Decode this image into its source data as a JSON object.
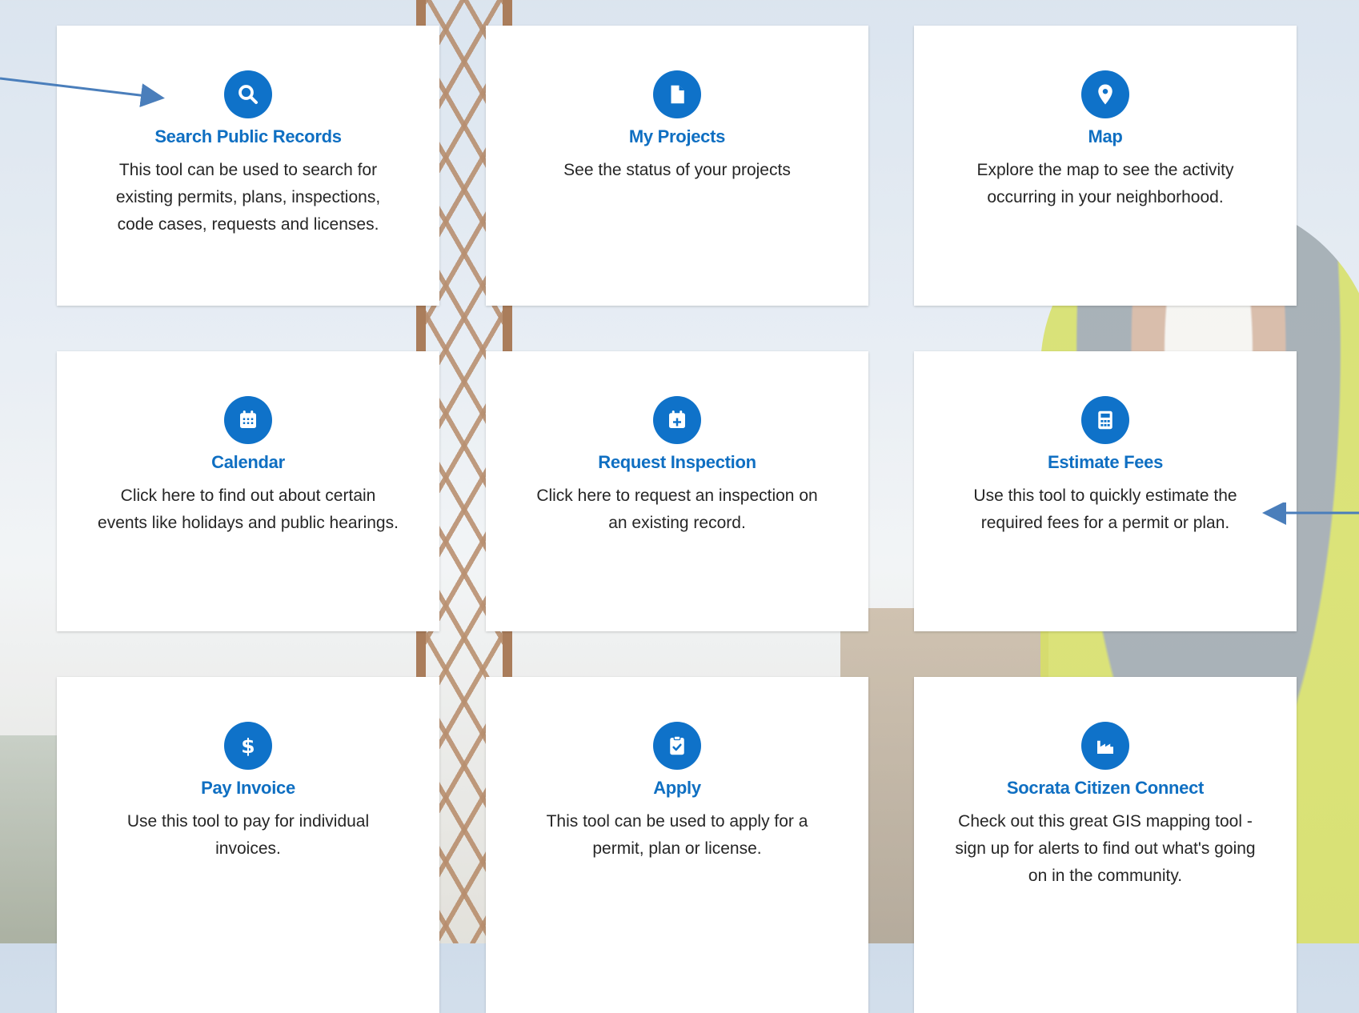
{
  "colors": {
    "accent": "#0f72c9",
    "title": "#0f6fc2",
    "text": "#262626",
    "arrow": "#4a7ebb"
  },
  "cards": [
    {
      "title": "Search Public Records",
      "desc": "This tool can be used to search for existing permits, plans, inspections, code cases, requests and licenses.",
      "icon": "search-icon"
    },
    {
      "title": "My Projects",
      "desc": "See the status of your projects",
      "icon": "document-icon"
    },
    {
      "title": "Map",
      "desc": "Explore the map to see the activity occurring in your neighborhood.",
      "icon": "map-pin-icon"
    },
    {
      "title": "Calendar",
      "desc": "Click here to find out about certain events like holidays and public hearings.",
      "icon": "calendar-icon"
    },
    {
      "title": "Request Inspection",
      "desc": "Click here to request an inspection on an existing record.",
      "icon": "calendar-plus-icon"
    },
    {
      "title": "Estimate Fees",
      "desc": "Use this tool to quickly estimate the required fees for a permit or plan.",
      "icon": "calculator-icon"
    },
    {
      "title": "Pay Invoice",
      "desc": "Use this tool to pay for individual invoices.",
      "icon": "dollar-icon"
    },
    {
      "title": "Apply",
      "desc": "This tool can be used to apply for a permit, plan or license.",
      "icon": "clipboard-check-icon"
    },
    {
      "title": "Socrata Citizen Connect",
      "desc": "Check out this great GIS mapping tool - sign up for alerts to find out what's going on in the community.",
      "icon": "factory-icon"
    }
  ]
}
